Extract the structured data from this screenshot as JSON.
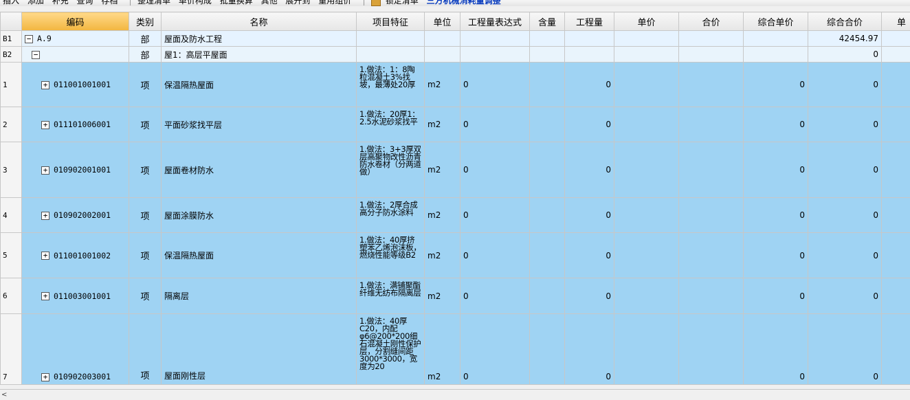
{
  "toolbar": {
    "items": [
      "插入",
      "添加",
      "补充",
      "查询",
      "存档"
    ],
    "actions": [
      "整理清单",
      "单价构成",
      "批量换算",
      "其他",
      "展开到",
      "重用组价"
    ],
    "lock_label": "锁定清单",
    "link_label": "三方机械消耗量调整"
  },
  "columns": {
    "code": "编码",
    "category": "类别",
    "name": "名称",
    "features": "项目特征",
    "unit": "单位",
    "expr": "工程量表达式",
    "content": "含量",
    "qty": "工程量",
    "price": "单价",
    "total": "合价",
    "comp_price": "综合单价",
    "comp_total": "综合合价",
    "next": "单"
  },
  "rows": [
    {
      "rownum": "B1",
      "kind": "lv1",
      "tree": "−",
      "code": "A.9",
      "category": "部",
      "name": "屋面及防水工程",
      "features": "",
      "unit": "",
      "expr": "",
      "qty": "",
      "comp_price": "",
      "comp_total": "42454.97"
    },
    {
      "rownum": "B2",
      "kind": "lv2",
      "tree": "−",
      "code": "",
      "category": "部",
      "name": "屋1：高层平屋面",
      "features": "",
      "unit": "",
      "expr": "",
      "qty": "",
      "comp_price": "",
      "comp_total": "0"
    },
    {
      "rownum": "1",
      "kind": "item",
      "tree": "+",
      "code": "011001001001",
      "category": "项",
      "name": "保温隔热屋面",
      "features": "1.做法：1：8陶粒混凝土3%找坡，最薄处20厚",
      "unit": "m2",
      "expr": "0",
      "qty": "0",
      "comp_price": "0",
      "comp_total": "0"
    },
    {
      "rownum": "2",
      "kind": "item",
      "tree": "+",
      "code": "011101006001",
      "category": "项",
      "name": "平面砂浆找平层",
      "features": "1.做法：20厚1：2.5水泥砂浆找平",
      "unit": "m2",
      "expr": "0",
      "qty": "0",
      "comp_price": "0",
      "comp_total": "0"
    },
    {
      "rownum": "3",
      "kind": "item",
      "tree": "+",
      "code": "010902001001",
      "category": "项",
      "name": "屋面卷材防水",
      "features": "1.做法：3+3厚双层高聚物改性沥青防水卷材（分两道做）",
      "unit": "m2",
      "expr": "0",
      "qty": "0",
      "comp_price": "0",
      "comp_total": "0"
    },
    {
      "rownum": "4",
      "kind": "item",
      "tree": "+",
      "code": "010902002001",
      "category": "项",
      "name": "屋面涂膜防水",
      "features": "1.做法：2厚合成高分子防水涂料",
      "unit": "m2",
      "expr": "0",
      "qty": "0",
      "comp_price": "0",
      "comp_total": "0"
    },
    {
      "rownum": "5",
      "kind": "item",
      "tree": "+",
      "code": "011001001002",
      "category": "项",
      "name": "保温隔热屋面",
      "features": "1.做法：40厚挤塑苯乙烯泡沫板，燃烧性能等级B2",
      "unit": "m2",
      "expr": "0",
      "qty": "0",
      "comp_price": "0",
      "comp_total": "0"
    },
    {
      "rownum": "6",
      "kind": "item",
      "tree": "+",
      "code": "011003001001",
      "category": "项",
      "name": "隔离层",
      "features": "1.做法：满铺聚酯纤维无纺布隔离层",
      "unit": "m2",
      "expr": "0",
      "qty": "0",
      "comp_price": "0",
      "comp_total": "0"
    },
    {
      "rownum": "7",
      "kind": "item",
      "tree": "+",
      "code": "010902003001",
      "category": "项",
      "name": "屋面刚性层",
      "features": "1.做法：40厚C20，内配φ6@200*200细石混凝土刚性保护层，分割缝间距3000*3000，宽度为20",
      "unit": "m2",
      "expr": "0",
      "qty": "0",
      "comp_price": "0",
      "comp_total": "0"
    }
  ],
  "statusbar": {
    "left_arrow": "<"
  }
}
